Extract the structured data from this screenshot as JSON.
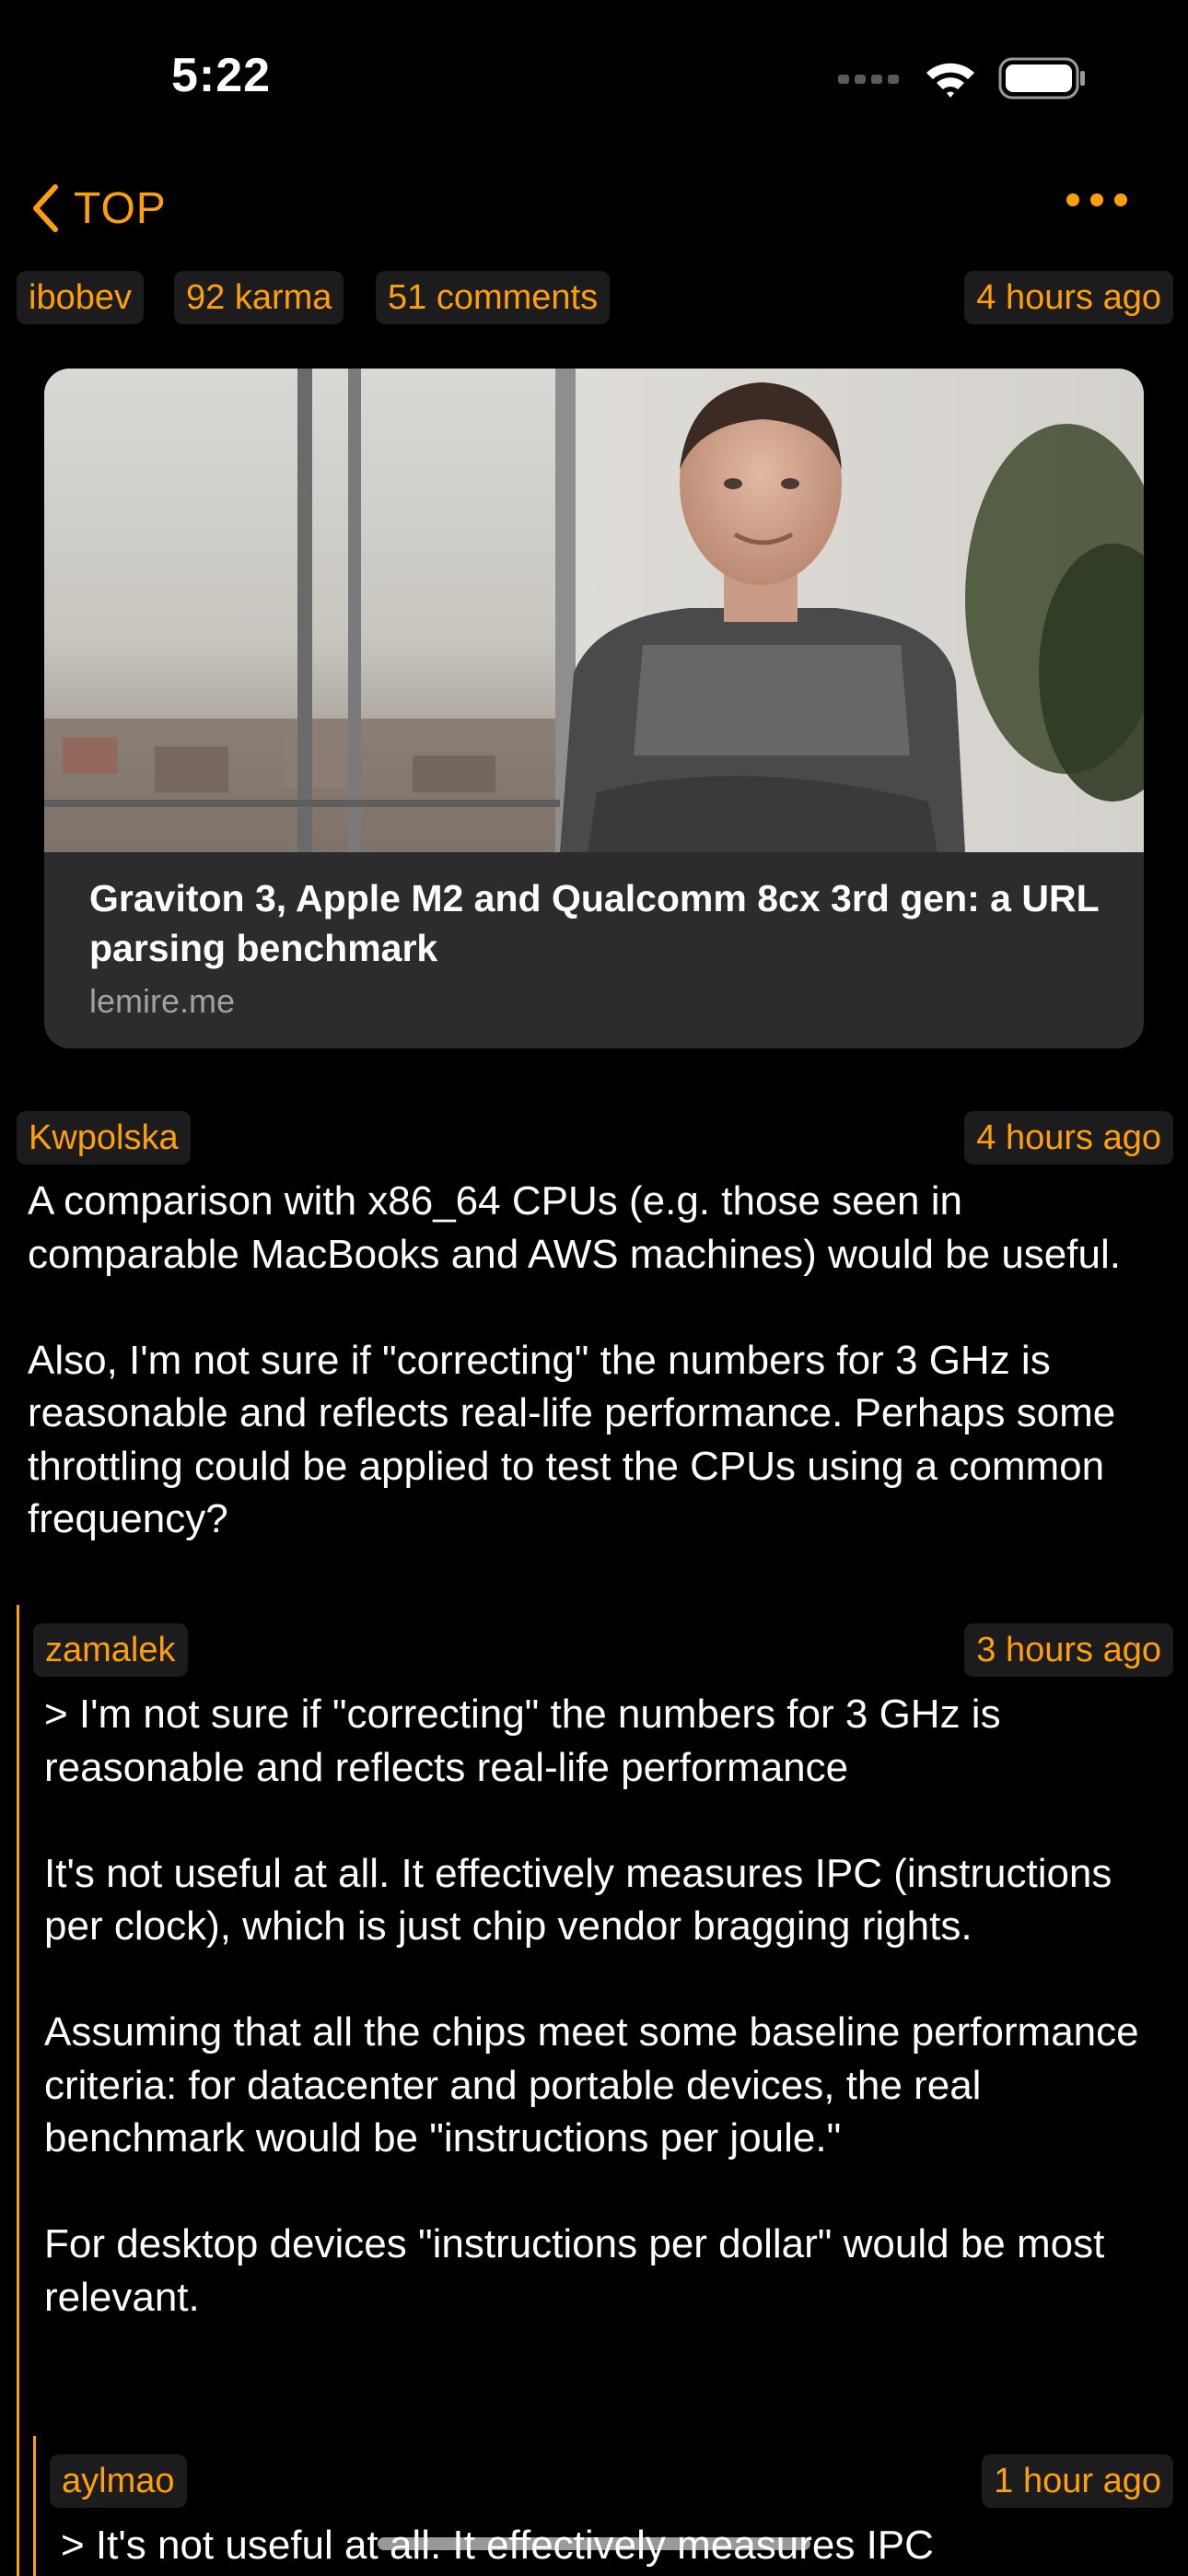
{
  "status_bar": {
    "time": "5:22"
  },
  "nav": {
    "back_label": "TOP"
  },
  "story": {
    "author": "ibobev",
    "karma": "92 karma",
    "comments_count": "51 comments",
    "age": "4 hours ago",
    "link": {
      "title": "Graviton 3, Apple M2 and Qualcomm 8cx 3rd gen: a URL parsing benchmark",
      "domain": "lemire.me"
    }
  },
  "comments": [
    {
      "author": "Kwpolska",
      "age": "4 hours ago",
      "text": "A comparison with x86_64 CPUs (e.g. those seen in comparable MacBooks and AWS machines) would be useful.\n\nAlso, I'm not sure if \"correcting\" the numbers for 3 GHz is reasonable and reflects real-life performance. Perhaps some throttling could be applied to test the CPUs using a common frequency?"
    },
    {
      "author": "zamalek",
      "age": "3 hours ago",
      "text": "> I'm not sure if \"correcting\" the numbers for 3 GHz is reasonable and reflects real-life performance\n\nIt's not useful at all. It effectively measures IPC (instructions per clock), which is just chip vendor bragging rights.\n\nAssuming that all the chips meet some baseline performance criteria: for datacenter and portable devices, the real benchmark would be \"instructions per joule.\"\n\nFor desktop devices \"instructions per dollar\" would be most relevant."
    },
    {
      "author": "aylmao",
      "age": "1 hour ago",
      "text": "> It's not useful at all. It effectively measures IPC"
    }
  ],
  "colors": {
    "accent": "#ff9f0a",
    "background": "#000000",
    "chip_background": "#1c1c1e",
    "card_background": "#2c2c2e"
  },
  "icons": {
    "back": "chevron-left-icon",
    "more": "ellipsis-icon",
    "signal": "cellular-signal-icon",
    "wifi": "wifi-icon",
    "battery": "battery-icon"
  }
}
